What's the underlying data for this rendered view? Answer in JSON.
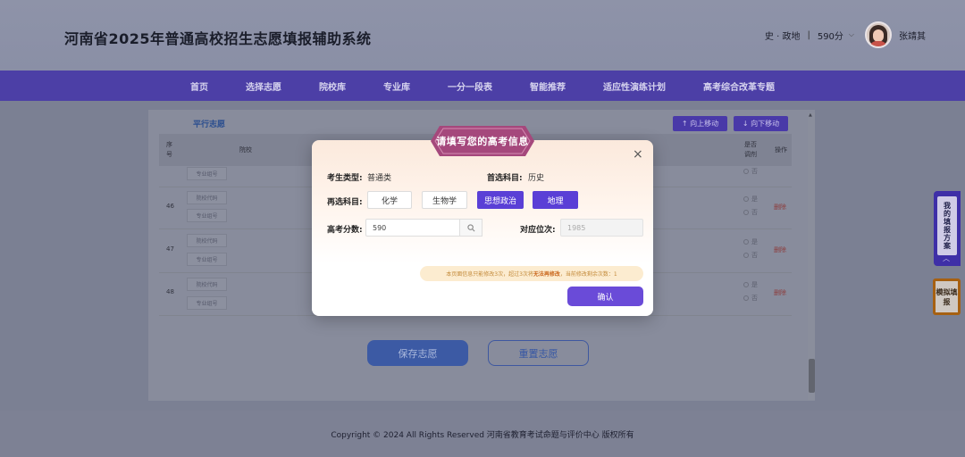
{
  "header": {
    "title": "河南省2025年普通高校招生志愿填报辅助系统",
    "subjects": "史 · 政地",
    "score": "590分",
    "user_name": "张靖其"
  },
  "nav": {
    "items": [
      "首页",
      "选择志愿",
      "院校库",
      "专业库",
      "一分一段表",
      "智能推荐",
      "适应性演练计划",
      "高考综合改革专题"
    ]
  },
  "panel": {
    "tab_label": "平行志愿",
    "move_up": "↑ 向上移动",
    "move_down": "↓ 向下移动",
    "headers": {
      "index": "序\n号",
      "school": "院校",
      "adjust": "是否\n调剂",
      "action": "操作"
    },
    "code_label": "院校代码",
    "major_label": "专业组号",
    "yes": "是",
    "no": "否",
    "delete": "删除",
    "rows": [
      "46",
      "47",
      "48"
    ],
    "save_button": "保存志愿",
    "reset_button": "重置志愿"
  },
  "modal": {
    "title": "请填写您的高考信息",
    "exam_type_label": "考生类型:",
    "exam_type_value": "普通类",
    "first_subject_label": "首选科目:",
    "first_subject_value": "历史",
    "second_subject_label": "再选科目:",
    "second_subjects": [
      {
        "label": "化学",
        "selected": false
      },
      {
        "label": "生物学",
        "selected": false
      },
      {
        "label": "思想政治",
        "selected": true
      },
      {
        "label": "地理",
        "selected": true
      }
    ],
    "score_label": "高考分数:",
    "score_value": "590",
    "rank_label": "对应位次:",
    "rank_value": "1985",
    "notice_prefix": "本页面信息只能修改3次，超过3次将",
    "notice_bold": "无法再修改",
    "notice_suffix": "，当前修改剩余次数：1",
    "confirm": "确认"
  },
  "float": {
    "plan": "我的填报方案",
    "mock": "模拟填报"
  },
  "footer": {
    "copyright": "Copyright © 2024 All Rights Reserved  河南省教育考试命题与评价中心  版权所有"
  },
  "colors": {
    "nav_bg": "#4c3fa6",
    "accent": "#5a3fd6",
    "ribbon": "#a64a7c"
  }
}
